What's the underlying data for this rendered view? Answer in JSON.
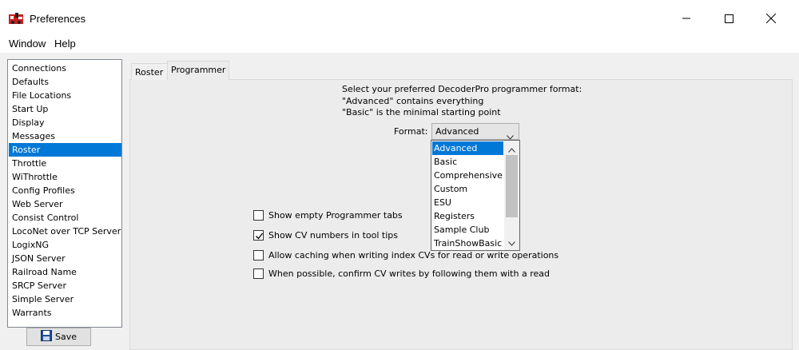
{
  "window": {
    "title": "Preferences",
    "controls": {
      "minimize": "minimize-icon",
      "maximize": "maximize-icon",
      "close": "close-icon"
    }
  },
  "menu": [
    "Window",
    "Help"
  ],
  "sidebar": {
    "items": [
      "Connections",
      "Defaults",
      "File Locations",
      "Start Up",
      "Display",
      "Messages",
      "Roster",
      "Throttle",
      "WiThrottle",
      "Config Profiles",
      "Web Server",
      "Consist Control",
      "LocoNet over TCP Server",
      "LogixNG",
      "JSON Server",
      "Railroad Name",
      "SRCP Server",
      "Simple Server",
      "Warrants"
    ],
    "selected": "Roster"
  },
  "save_button": {
    "label": "Save",
    "icon": "floppy-disk-icon"
  },
  "tabs": [
    {
      "label": "Roster",
      "active": false
    },
    {
      "label": "Programmer",
      "active": true
    }
  ],
  "programmer": {
    "description": [
      "Select your preferred DecoderPro programmer format:",
      "\"Advanced\" contains everything",
      "\"Basic\" is the minimal starting point"
    ],
    "format_label": "Format:",
    "format_value": "Advanced",
    "format_options": [
      "Advanced",
      "Basic",
      "Comprehensive",
      "Custom",
      "ESU",
      "Registers",
      "Sample Club",
      "TrainShowBasic"
    ],
    "checkboxes": [
      {
        "label": "Show empty Programmer tabs",
        "checked": false
      },
      {
        "label": "Show CV numbers in tool tips",
        "checked": true
      },
      {
        "label": "Allow caching when writing index CVs for read or write operations",
        "checked": false
      },
      {
        "label": "When possible, confirm CV writes by following them with a read",
        "checked": false
      }
    ]
  },
  "colors": {
    "selection": "#0078d7",
    "panel": "#f0f0f0"
  }
}
